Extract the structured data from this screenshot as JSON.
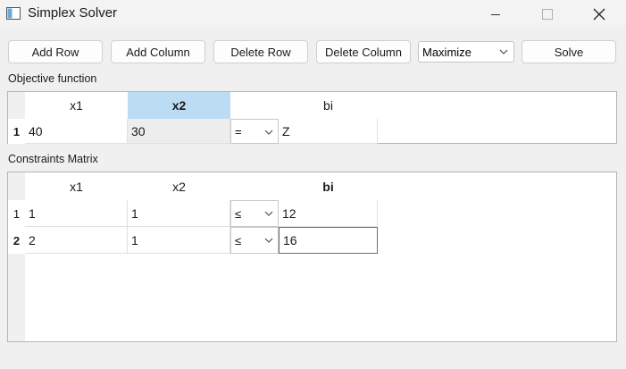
{
  "window": {
    "title": "Simplex Solver"
  },
  "toolbar": {
    "add_row": "Add Row",
    "add_column": "Add Column",
    "delete_row": "Delete Row",
    "delete_column": "Delete Column",
    "mode_selected": "Maximize",
    "solve": "Solve"
  },
  "objective": {
    "label": "Objective function",
    "headers": [
      "x1",
      "x2",
      "",
      "bi"
    ],
    "row_header": "1",
    "row": {
      "x1": "40",
      "x2": "30",
      "op": "=",
      "bi": "Z"
    }
  },
  "constraints": {
    "label": "Constraints Matrix",
    "headers": [
      "x1",
      "x2",
      "",
      "bi"
    ],
    "rows": [
      {
        "header": "1",
        "x1": "1",
        "x2": "1",
        "op": "≤",
        "bi": "12"
      },
      {
        "header": "2",
        "x1": "2",
        "x2": "1",
        "op": "≤",
        "bi": "16"
      }
    ]
  },
  "colors": {
    "selected_header": "#bcdcf4",
    "window_bg": "#f0f0f0"
  }
}
